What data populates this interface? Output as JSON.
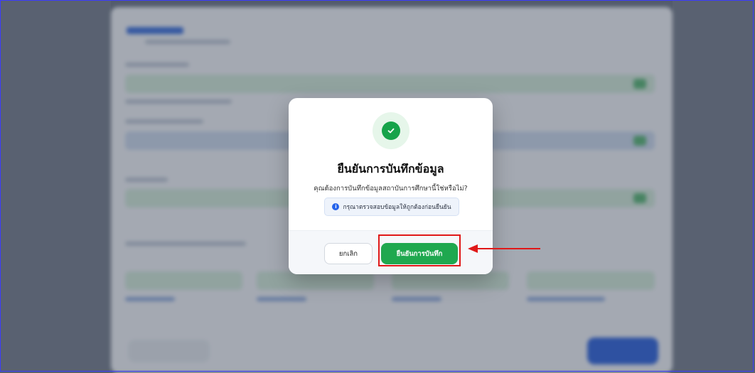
{
  "modal": {
    "title": "ยืนยันการบันทึกข้อมูล",
    "subtitle": "คุณต้องการบันทึกข้อมูลสถาบันการศึกษานี้ใช่หรือไม่?",
    "info_text": "กรุณาตรวจสอบข้อมูลให้ถูกต้องก่อนยืนยัน",
    "info_icon": "i",
    "cancel_label": "ยกเลิก",
    "confirm_label": "ยืนยันการบันทึก",
    "success_icon": "check-icon"
  },
  "colors": {
    "confirm": "#1fa84f",
    "highlight": "#e01818",
    "info": "#2563eb"
  }
}
